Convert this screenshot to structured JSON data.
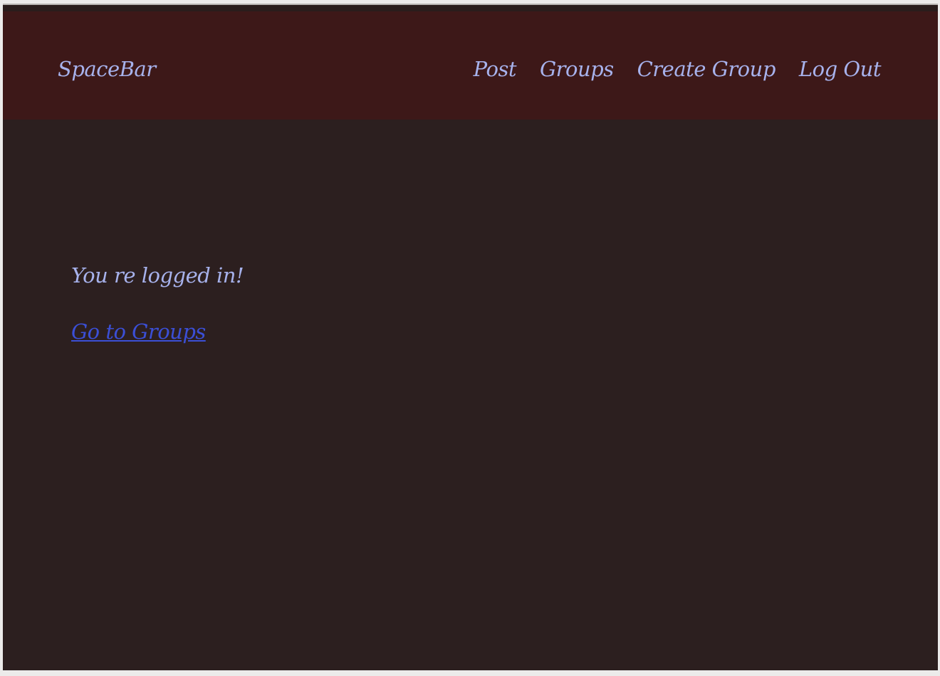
{
  "navbar": {
    "brand": "SpaceBar",
    "links": [
      {
        "label": "Post"
      },
      {
        "label": "Groups"
      },
      {
        "label": "Create Group"
      },
      {
        "label": "Log Out"
      }
    ]
  },
  "main": {
    "message": "You re logged in!",
    "groups_link": "Go to Groups"
  },
  "colors": {
    "page_background": "#2c1f1f",
    "navbar_background": "#3d1818",
    "text": "#a7b2ec",
    "link": "#3b4fd6"
  }
}
